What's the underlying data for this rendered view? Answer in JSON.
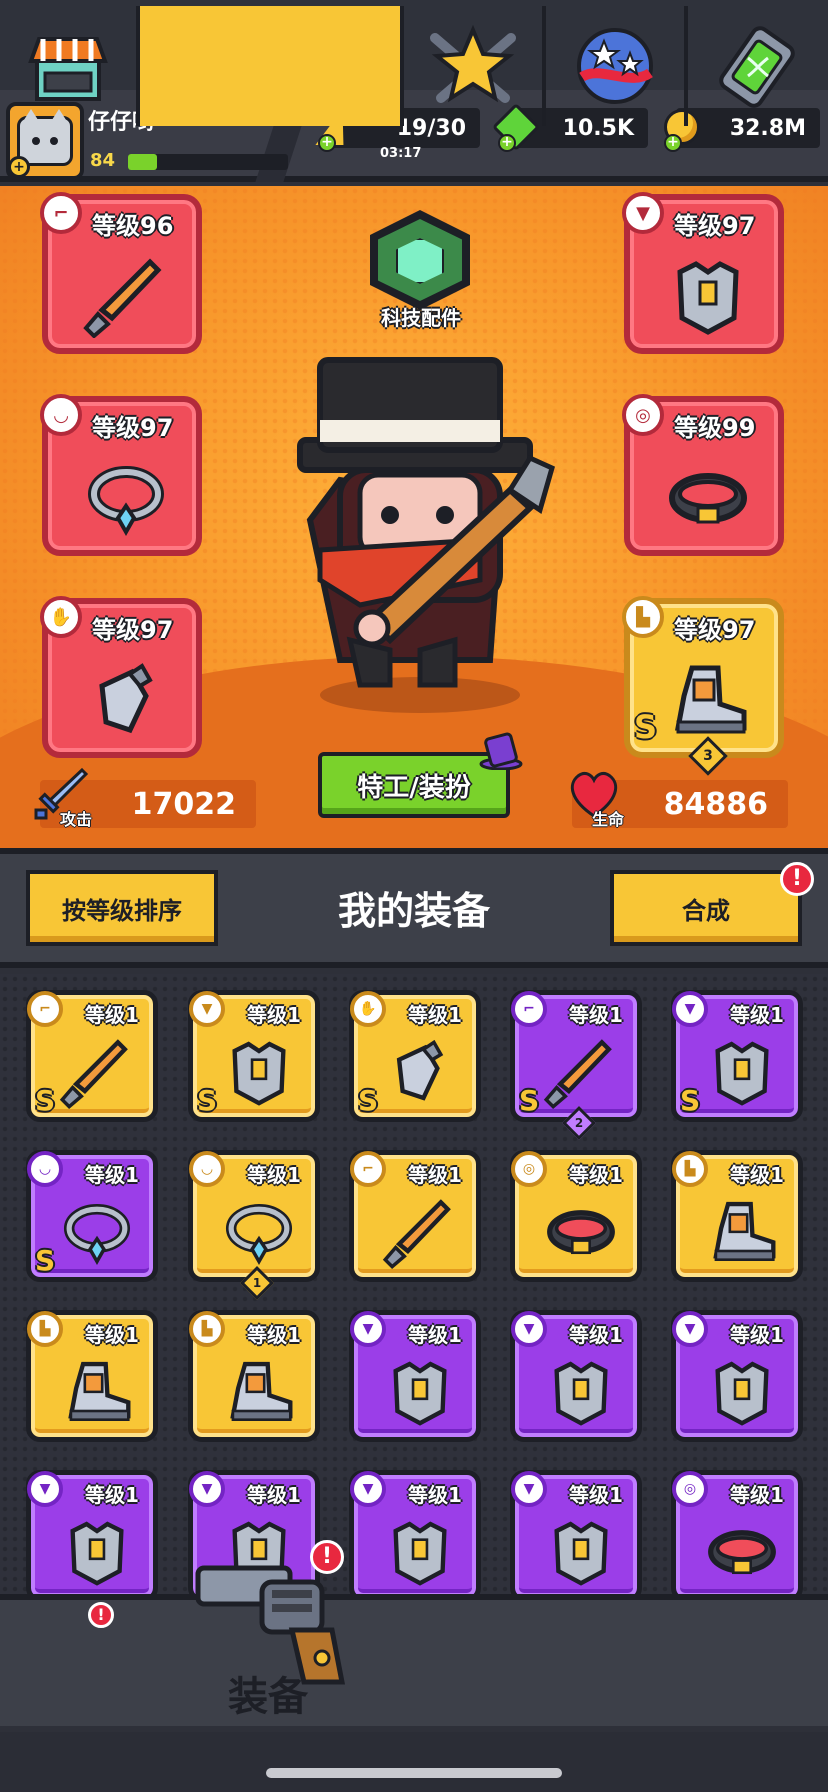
{
  "player": {
    "name": "仔仔哟",
    "level": "84",
    "xp_fraction": 0.18
  },
  "resources": {
    "energy": {
      "value": "19/30",
      "timer": "03:17"
    },
    "gems": {
      "value": "10.5K"
    },
    "coins": {
      "value": "32.8M"
    }
  },
  "hero": {
    "tech_label": "科技配件",
    "agent_button": "特工/装扮",
    "attack": {
      "label": "攻击",
      "value": "17022"
    },
    "life": {
      "label": "生命",
      "value": "84886"
    },
    "slots": [
      {
        "level": "等级96",
        "type": "weapon-icon",
        "rarity": "red"
      },
      {
        "level": "等级97",
        "type": "necklace-icon",
        "rarity": "red"
      },
      {
        "level": "等级97",
        "type": "glove-icon",
        "rarity": "red"
      },
      {
        "level": "等级97",
        "type": "armor-icon",
        "rarity": "red"
      },
      {
        "level": "等级99",
        "type": "belt-icon",
        "rarity": "red"
      },
      {
        "level": "等级97",
        "type": "boot-icon",
        "rarity": "gold",
        "grade": "S",
        "stars": "3"
      }
    ]
  },
  "equipment": {
    "sort_button": "按等级排序",
    "title": "我的装备",
    "merge_button": "合成",
    "merge_alert": "!",
    "items": [
      {
        "level": "等级1",
        "rarity": "gold",
        "grade": "S",
        "type": "weapon-icon"
      },
      {
        "level": "等级1",
        "rarity": "gold",
        "grade": "S",
        "type": "armor-icon"
      },
      {
        "level": "等级1",
        "rarity": "gold",
        "grade": "S",
        "type": "glove-icon"
      },
      {
        "level": "等级1",
        "rarity": "purple",
        "grade": "S",
        "type": "weapon-icon",
        "stars": "2"
      },
      {
        "level": "等级1",
        "rarity": "purple",
        "grade": "S",
        "type": "armor-icon"
      },
      {
        "level": "等级1",
        "rarity": "purple",
        "grade": "S",
        "type": "necklace-icon"
      },
      {
        "level": "等级1",
        "rarity": "gold",
        "grade": "",
        "type": "necklace-icon",
        "stars": "1"
      },
      {
        "level": "等级1",
        "rarity": "gold",
        "grade": "",
        "type": "weapon-icon"
      },
      {
        "level": "等级1",
        "rarity": "gold",
        "grade": "",
        "type": "belt-icon"
      },
      {
        "level": "等级1",
        "rarity": "gold",
        "grade": "",
        "type": "boot-icon"
      },
      {
        "level": "等级1",
        "rarity": "gold",
        "grade": "",
        "type": "boot-icon"
      },
      {
        "level": "等级1",
        "rarity": "gold",
        "grade": "",
        "type": "boot-icon"
      },
      {
        "level": "等级1",
        "rarity": "purple",
        "grade": "",
        "type": "armor-icon"
      },
      {
        "level": "等级1",
        "rarity": "purple",
        "grade": "",
        "type": "armor-icon"
      },
      {
        "level": "等级1",
        "rarity": "purple",
        "grade": "",
        "type": "armor-icon"
      },
      {
        "level": "等级1",
        "rarity": "purple",
        "grade": "",
        "type": "armor-icon"
      },
      {
        "level": "等级1",
        "rarity": "purple",
        "grade": "",
        "type": "armor-icon"
      },
      {
        "level": "等级1",
        "rarity": "purple",
        "grade": "",
        "type": "armor-icon"
      },
      {
        "level": "等级1",
        "rarity": "purple",
        "grade": "",
        "type": "armor-icon"
      },
      {
        "level": "等级1",
        "rarity": "purple",
        "grade": "",
        "type": "belt-icon"
      }
    ]
  },
  "nav": {
    "active_label": "装备",
    "alert": "!",
    "tabs": [
      "shop-icon",
      "gun-icon",
      "star-icon",
      "planet-icon",
      "dna-icon"
    ]
  },
  "colors": {
    "gold": "#f8c636",
    "purple": "#9b3ee8",
    "red": "#f04d5a",
    "green": "#7ad22b",
    "dark": "#1d1f26"
  }
}
